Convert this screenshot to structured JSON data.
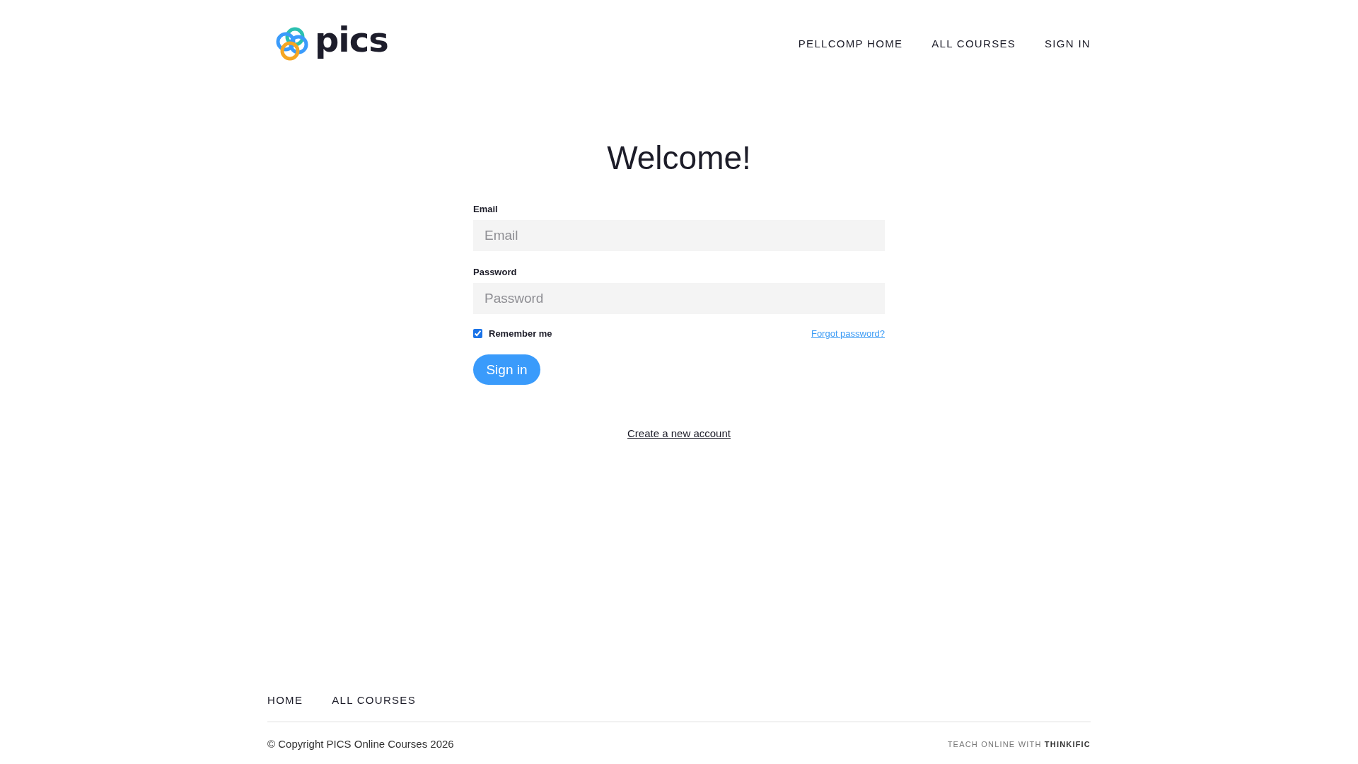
{
  "header": {
    "logo_text": "pics",
    "nav": [
      "PELLCOMP HOME",
      "ALL COURSES",
      "SIGN IN"
    ]
  },
  "login": {
    "title": "Welcome!",
    "fields": [
      {
        "label": "Email",
        "placeholder": "Email"
      },
      {
        "label": "Password",
        "placeholder": "Password"
      }
    ],
    "remember": {
      "label": "Remember me",
      "checked": true
    },
    "forgot": "Forgot password?",
    "submit": "Sign in",
    "create": "Create a new account"
  },
  "footer": {
    "nav": [
      "HOME",
      "ALL COURSES"
    ],
    "copyright": "© Copyright PICS Online Courses 2026",
    "badge": "TEACH ONLINE WITH **THINKIFIC**"
  }
}
